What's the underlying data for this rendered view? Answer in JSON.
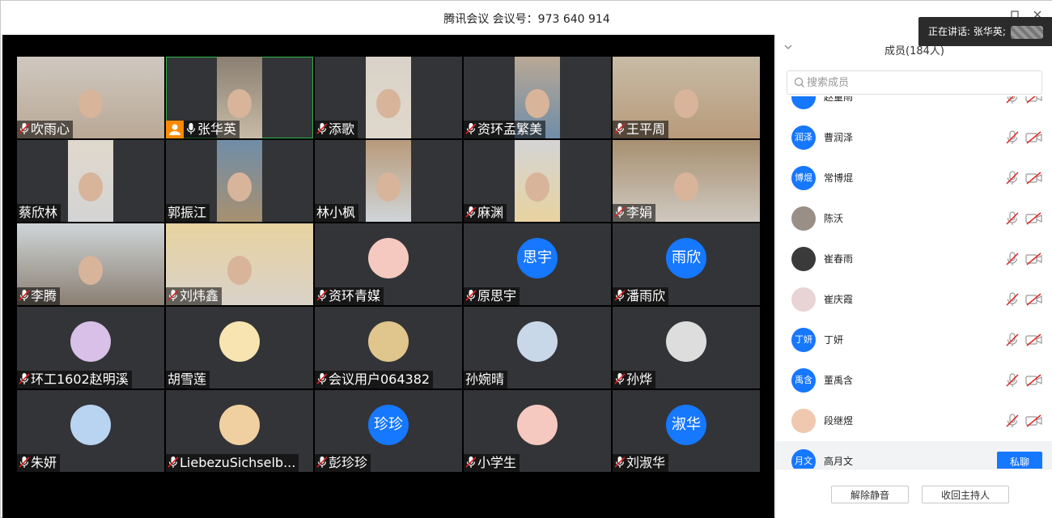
{
  "window": {
    "title": "腾讯会议 会议号：973 640 914",
    "speaking_prefix": "正在讲话: 张华英;"
  },
  "colors": {
    "accent": "#1677ff",
    "host_badge": "#ff8a00",
    "active_border": "#2fb54a",
    "muted_red": "#e02020"
  },
  "tiles": [
    {
      "name": "吹雨心",
      "mic": "muted",
      "view": "camera"
    },
    {
      "name": "张华英",
      "mic": "on",
      "view": "camera",
      "host": true,
      "active": true
    },
    {
      "name": "添歌",
      "mic": "muted",
      "view": "camera"
    },
    {
      "name": "资环孟繁美",
      "mic": "muted",
      "view": "camera"
    },
    {
      "name": "王平周",
      "mic": "muted",
      "view": "camera"
    },
    {
      "name": "蔡欣林",
      "mic": "none",
      "view": "camera"
    },
    {
      "name": "郭振江",
      "mic": "none",
      "view": "camera"
    },
    {
      "name": "林小枫",
      "mic": "none",
      "view": "camera"
    },
    {
      "name": "麻渊",
      "mic": "muted",
      "view": "camera"
    },
    {
      "name": "李娟",
      "mic": "muted",
      "view": "camera"
    },
    {
      "name": "李腾",
      "mic": "muted",
      "view": "camera"
    },
    {
      "name": "刘炜鑫",
      "mic": "muted",
      "view": "camera"
    },
    {
      "name": "资环青媒",
      "mic": "muted",
      "view": "avatar-image"
    },
    {
      "name": "原思宇",
      "mic": "muted",
      "view": "avatar-text",
      "avatar_text": "思宇"
    },
    {
      "name": "潘雨欣",
      "mic": "muted",
      "view": "avatar-text",
      "avatar_text": "雨欣"
    },
    {
      "name": "环工1602赵明溪",
      "mic": "muted",
      "view": "avatar-image"
    },
    {
      "name": "胡雪莲",
      "mic": "none",
      "view": "avatar-image"
    },
    {
      "name": "会议用户064382",
      "mic": "muted",
      "view": "avatar-image"
    },
    {
      "name": "孙婉晴",
      "mic": "none",
      "view": "avatar-image"
    },
    {
      "name": "孙烨",
      "mic": "muted",
      "view": "avatar-image"
    },
    {
      "name": "朱妍",
      "mic": "muted",
      "view": "avatar-image"
    },
    {
      "name": "LiebezuSichselb...",
      "mic": "muted",
      "view": "avatar-image"
    },
    {
      "name": "彭珍珍",
      "mic": "muted",
      "view": "avatar-text",
      "avatar_text": "珍珍"
    },
    {
      "name": "小学生",
      "mic": "muted",
      "view": "avatar-image"
    },
    {
      "name": "刘淑华",
      "mic": "muted",
      "view": "avatar-text",
      "avatar_text": "淑华"
    }
  ],
  "panel": {
    "title": "成员(184人)",
    "search_placeholder": "搜索成员",
    "members": [
      {
        "name": "赵量雨",
        "avatar_text": "",
        "kind": "text"
      },
      {
        "name": "曹润泽",
        "avatar_text": "润泽",
        "kind": "text"
      },
      {
        "name": "常博焜",
        "avatar_text": "博焜",
        "kind": "text"
      },
      {
        "name": "陈沃",
        "avatar_text": "",
        "kind": "image"
      },
      {
        "name": "崔春雨",
        "avatar_text": "",
        "kind": "image"
      },
      {
        "name": "崔庆霞",
        "avatar_text": "",
        "kind": "image"
      },
      {
        "name": "丁妍",
        "avatar_text": "丁妍",
        "kind": "text"
      },
      {
        "name": "董禹含",
        "avatar_text": "禹含",
        "kind": "text"
      },
      {
        "name": "段继煜",
        "avatar_text": "",
        "kind": "image"
      },
      {
        "name": "高月文",
        "avatar_text": "月文",
        "kind": "text",
        "highlighted": true
      }
    ],
    "private_chat_label": "私聊",
    "unmute_all_label": "解除静音",
    "reclaim_host_label": "收回主持人"
  }
}
